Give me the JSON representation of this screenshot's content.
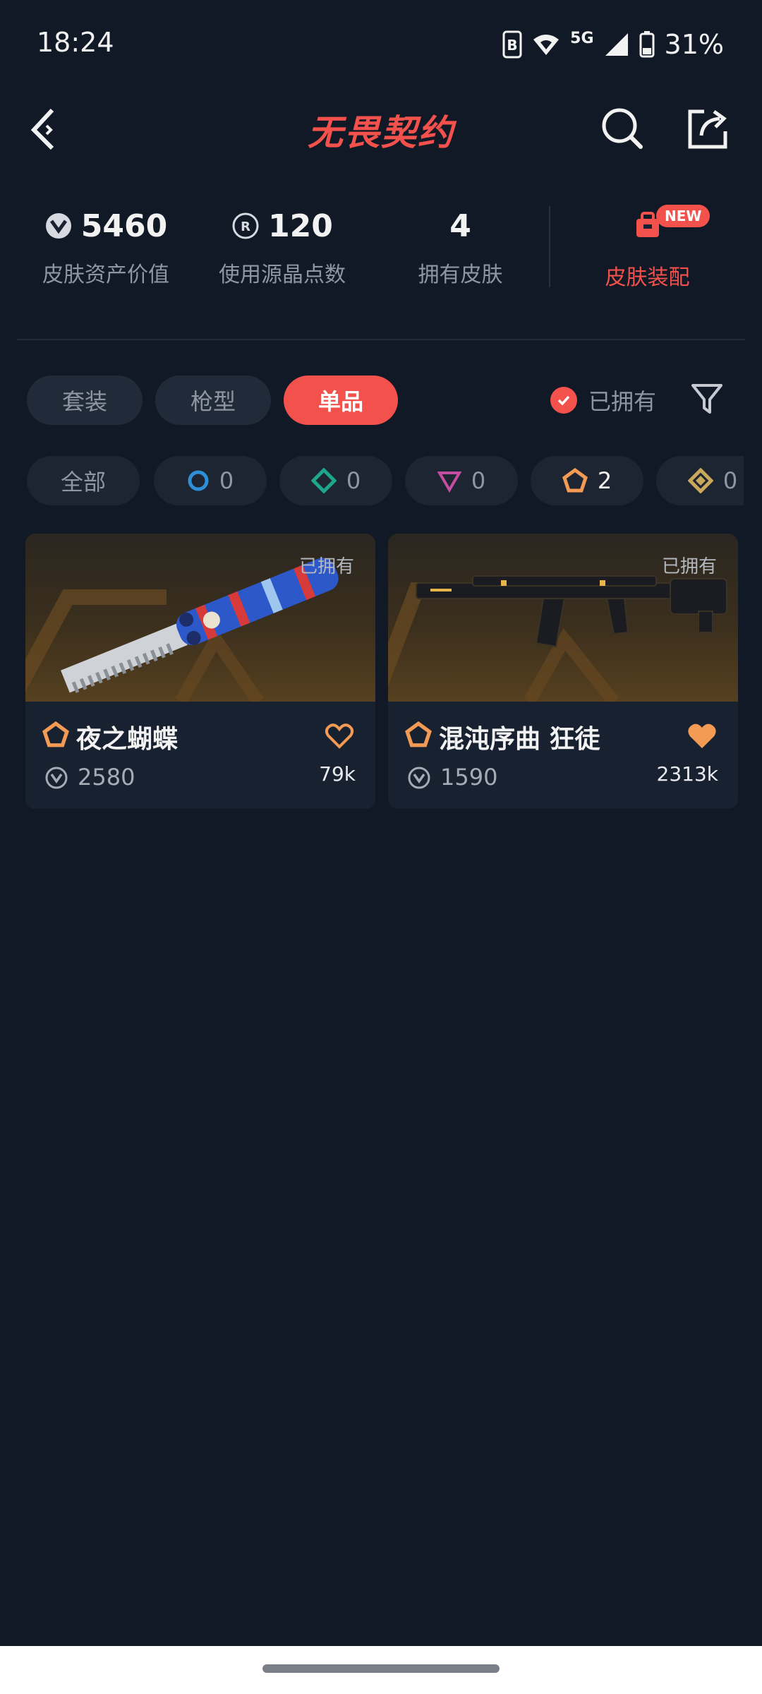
{
  "status_bar": {
    "time": "18:24",
    "network": "5G",
    "battery": "31%"
  },
  "header": {
    "title": "无畏契约",
    "icons": [
      "back-arrow-icon",
      "search-icon",
      "share-icon"
    ]
  },
  "stats": {
    "asset_value": "5460",
    "asset_label": "皮肤资产价值",
    "points_value": "120",
    "points_label": "使用源晶点数",
    "owned_value": "4",
    "owned_label": "拥有皮肤",
    "loadout_label": "皮肤装配",
    "new_badge": "NEW"
  },
  "tabs": {
    "items": [
      "套装",
      "枪型",
      "单品"
    ],
    "active": "单品"
  },
  "owned_filter": {
    "label": "已拥有",
    "checked": true
  },
  "rarity_filters": [
    {
      "label": "全部"
    },
    {
      "icon": "rarity-blue-circle-icon",
      "count": "0",
      "color": "#2f8fd6"
    },
    {
      "icon": "rarity-green-diamond-icon",
      "count": "0",
      "color": "#1fa58c"
    },
    {
      "icon": "rarity-purple-triangle-icon",
      "count": "0",
      "color": "#c34da1"
    },
    {
      "icon": "rarity-orange-pentagon-icon",
      "count": "2",
      "color": "#f39a55"
    },
    {
      "icon": "rarity-gold-diamond-icon",
      "count": "0",
      "color": "#c9a85b"
    }
  ],
  "cards": [
    {
      "name": "夜之蝴蝶",
      "owned_tag": "已拥有",
      "price": "2580",
      "likes": "79k",
      "liked": false,
      "rarity_color": "#f39a55"
    },
    {
      "name": "混沌序曲 狂徒",
      "owned_tag": "已拥有",
      "price": "1590",
      "likes": "2313k",
      "liked": true,
      "rarity_color": "#f39a55"
    }
  ],
  "colors": {
    "accent": "#f2514c",
    "background": "#111926",
    "heart": "#f39a55"
  }
}
